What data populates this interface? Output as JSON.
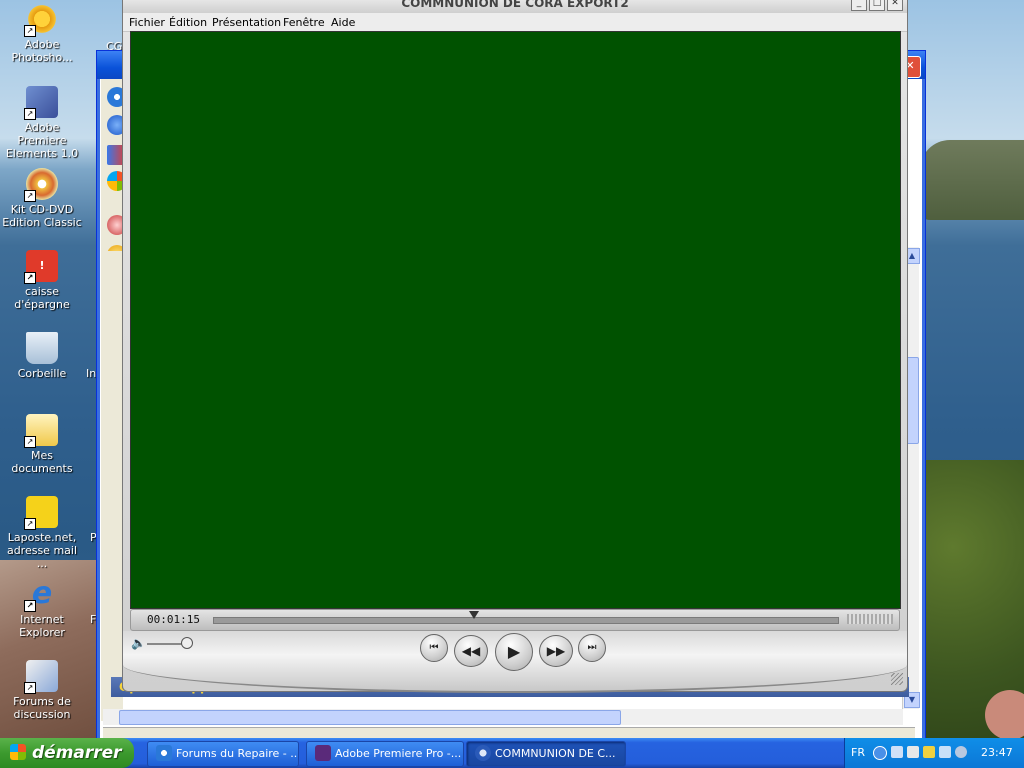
{
  "desktop": {
    "icons": [
      {
        "label": "Adobe Photosho...",
        "icon": "photoshop-icon"
      },
      {
        "label": "Adobe Premiere Elements 1.0",
        "icon": "premiere-elements-icon"
      },
      {
        "label": "Kit CD-DVD Edition Classic",
        "icon": "cd-dvd-kit-icon"
      },
      {
        "label": "caisse d'épargne",
        "icon": "caisse-epargne-icon"
      },
      {
        "label": "Corbeille",
        "icon": "recycle-bin-icon"
      },
      {
        "label": "Mes documents",
        "icon": "my-documents-icon"
      },
      {
        "label": "Laposte.net, adresse mail ...",
        "icon": "laposte-icon"
      },
      {
        "label": "Internet Explorer",
        "icon": "internet-explorer-icon"
      },
      {
        "label": "Forums de discussion",
        "icon": "forums-icon"
      }
    ],
    "partial_labels": [
      "CG",
      "In",
      "P",
      "F"
    ]
  },
  "ie_window": {
    "banner": "Options supplémentaires"
  },
  "qt_window": {
    "title": "COMMNUNION DE CORA EXPORT2",
    "menu": [
      "Fichier",
      "Édition",
      "Présentation",
      "Fenêtre",
      "Aide"
    ],
    "time": "00:01:15",
    "video_color": "#005200"
  },
  "taskbar": {
    "start_label": "démarrer",
    "items": [
      {
        "label": "Forums du Repaire - ...",
        "icon": "ie-icon"
      },
      {
        "label": "Adobe Premiere Pro -...",
        "icon": "premiere-pro-icon"
      },
      {
        "label": "COMMNUNION DE C...",
        "icon": "quicktime-icon"
      }
    ],
    "tray": {
      "lang": "FR",
      "clock": "23:47"
    }
  }
}
